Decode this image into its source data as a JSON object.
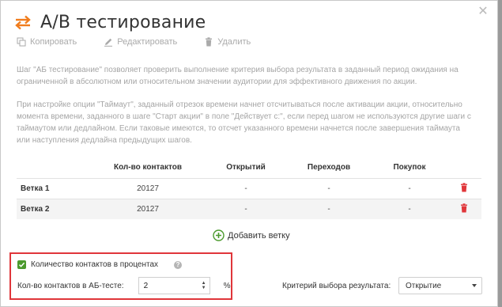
{
  "header": {
    "title": "А/В тестирование",
    "icon": "swap-arrows-icon",
    "accent": "#f07d1e"
  },
  "toolbar": {
    "copy_label": "Копировать",
    "edit_label": "Редактировать",
    "delete_label": "Удалить"
  },
  "description": {
    "p1": "Шаг \"АБ тестирование\" позволяет проверить выполнение критерия выбора результата в заданный период ожидания на ограниченной в абсолютном или относительном значении аудитории для эффективного движения по акции.",
    "p2": "При настройке опции \"Таймаут\", заданный отрезок времени начнет отсчитываться после активации акции, относительно момента времени, заданного в шаге \"Старт акции\" в поле \"Действует с:\", если перед шагом не используются другие шаги с таймаутом или дедлайном. Если таковые имеются, то отсчет указанного времени начнется после завершения таймаута или наступления дедлайна предыдущих шагов."
  },
  "table": {
    "columns": [
      "",
      "Кол-во контактов",
      "Открытий",
      "Переходов",
      "Покупок",
      ""
    ],
    "rows": [
      {
        "name": "Ветка 1",
        "contacts": "20127",
        "opens": "-",
        "clicks": "-",
        "purchases": "-"
      },
      {
        "name": "Ветка 2",
        "contacts": "20127",
        "opens": "-",
        "clicks": "-",
        "purchases": "-"
      }
    ],
    "delete_color": "#e0363a"
  },
  "add_branch_label": "Добавить ветку",
  "settings": {
    "percent_checkbox_label": "Количество контактов в процентах",
    "percent_checked": true,
    "help_glyph": "?",
    "count_label": "Кол-во контактов в АБ-тесте:",
    "count_value": "2",
    "percent_sign": "%",
    "criterion_label": "Критерий выбора результата:",
    "criterion_value": "Открытие"
  }
}
